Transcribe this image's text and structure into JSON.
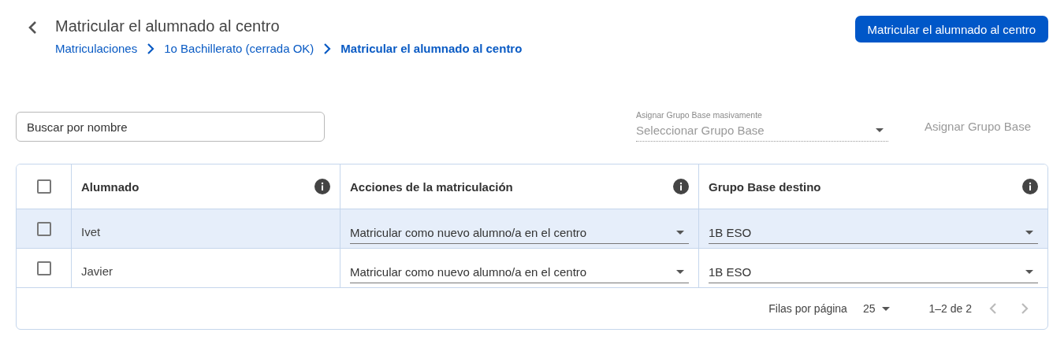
{
  "header": {
    "title": "Matricular el alumnado al centro",
    "breadcrumbs": [
      {
        "label": "Matriculaciones",
        "current": false
      },
      {
        "label": "1o Bachillerato (cerrada OK)",
        "current": false
      },
      {
        "label": "Matricular el alumnado al centro",
        "current": true
      }
    ],
    "action_button": "Matricular el alumnado al centro"
  },
  "filters": {
    "search": {
      "placeholder": "Buscar por nombre"
    },
    "bulk_group": {
      "label": "Asignar Grupo Base masivamente",
      "placeholder": "Seleccionar Grupo Base",
      "disabled": true
    },
    "assign_button": {
      "label": "Asignar Grupo Base",
      "disabled": true
    }
  },
  "table": {
    "select_all": {
      "checked": false
    },
    "columns": [
      "Alumnado",
      "Acciones de la matriculación",
      "Grupo Base destino"
    ],
    "rows": [
      {
        "checked": false,
        "highlighted": true,
        "name": "Ivet",
        "action": "Matricular como nuevo alumno/a en el centro",
        "group": "1B ESO"
      },
      {
        "checked": false,
        "highlighted": false,
        "name": "Javier",
        "action": "Matricular como nuevo alumno/a en el centro",
        "group": "1B ESO"
      }
    ],
    "pagination": {
      "rows_label": "Filas por página",
      "rows_per_page": "25",
      "range": "1–2 de 2"
    }
  }
}
